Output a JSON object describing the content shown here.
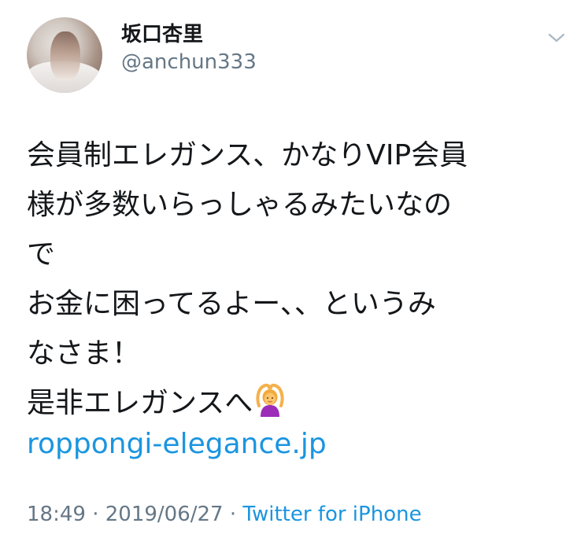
{
  "user": {
    "display_name": "坂口杏里",
    "handle": "@anchun333"
  },
  "tweet": {
    "lines": [
      "会員制エレガンス、かなりVIP会員",
      "様が多数いらっしゃるみたいなの",
      "で",
      "お金に困ってるよー、、というみ",
      "なさま！",
      "是非エレガンスへ"
    ],
    "emoji": "person-gesturing-ok",
    "link": "roppongi-elegance.jp"
  },
  "meta": {
    "time": "18:49",
    "sep1": " · ",
    "date": "2019/06/27",
    "sep2": " · ",
    "source": "Twitter for iPhone"
  },
  "icons": {
    "menu": "chevron-down-icon",
    "emoji": "person-gesturing-ok-icon"
  },
  "colors": {
    "text": "#14171a",
    "secondary": "#657786",
    "link": "#1b95e0"
  }
}
